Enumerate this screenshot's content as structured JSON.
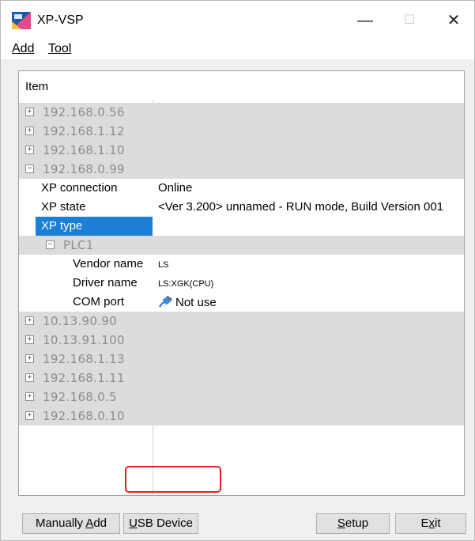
{
  "window": {
    "title": "XP-VSP",
    "minimize_glyph": "—",
    "maximize_glyph": "☐",
    "close_glyph": "✕"
  },
  "menu": {
    "add": "Add",
    "tool": "Tool"
  },
  "list": {
    "header_item": "Item",
    "nodes_top": [
      {
        "label": "192.168.0.56",
        "expander": "+"
      },
      {
        "label": "192.168.1.12",
        "expander": "+"
      },
      {
        "label": "192.168.1.10",
        "expander": "+"
      },
      {
        "label": "192.168.0.99",
        "expander": "−"
      }
    ],
    "expanded_props": {
      "xp_connection": {
        "key": "XP connection",
        "value": "Online"
      },
      "xp_state": {
        "key": "XP state",
        "value": "<Ver 3.200> unnamed - RUN mode, Build Version 001"
      },
      "xp_type": {
        "key": "XP type",
        "value": ""
      }
    },
    "plc": {
      "label": "PLC1",
      "expander": "−",
      "vendor_name": {
        "key": "Vendor name",
        "value": "LS"
      },
      "driver_name": {
        "key": "Driver name",
        "value": "LS:XGK(CPU)"
      },
      "com_port": {
        "key": "COM port",
        "value": "Not use"
      }
    },
    "nodes_bottom": [
      {
        "label": "10.13.90.90",
        "expander": "+"
      },
      {
        "label": "10.13.91.100",
        "expander": "+"
      },
      {
        "label": "192.168.1.13",
        "expander": "+"
      },
      {
        "label": "192.168.1.11",
        "expander": "+"
      },
      {
        "label": "192.168.0.5",
        "expander": "+"
      },
      {
        "label": "192.168.0.10",
        "expander": "+"
      }
    ]
  },
  "buttons": {
    "manually_add_pre": "Manually ",
    "manually_add_mnemonic": "A",
    "manually_add_post": "dd",
    "usb_mnemonic": "U",
    "usb_post": "SB Device",
    "setup_mnemonic": "S",
    "setup_post": "etup",
    "exit_pre": "E",
    "exit_mnemonic": "x",
    "exit_post": "it"
  },
  "colors": {
    "selection": "#1b7fd6",
    "highlight_box": "#e02020",
    "node_row_bg": "#dcdcdc"
  }
}
